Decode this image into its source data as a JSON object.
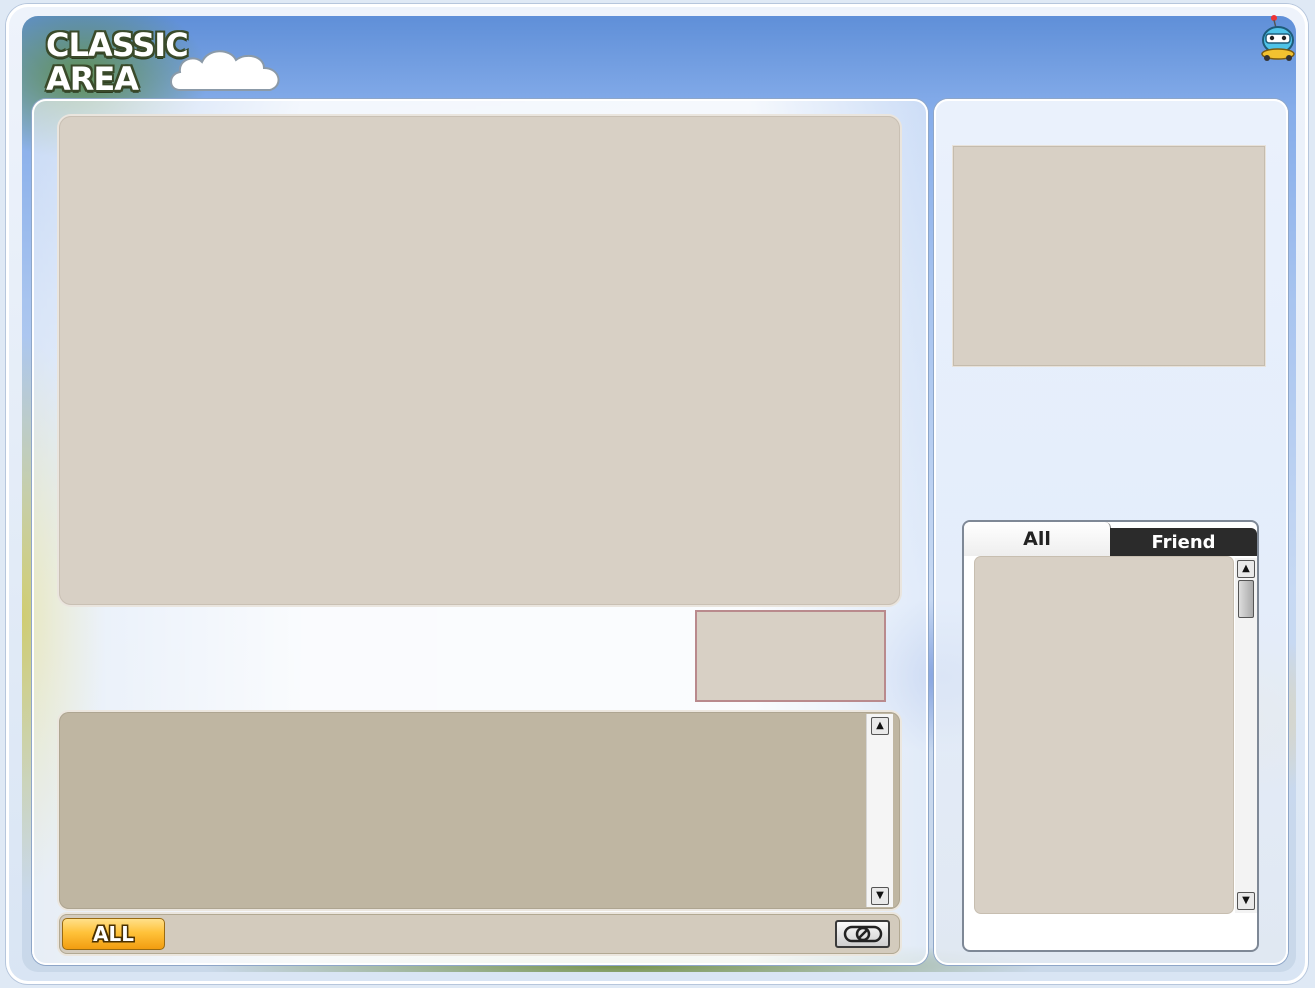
{
  "header": {
    "area_title_line1": "CLASSIC",
    "area_title_line2": "AREA"
  },
  "chat": {
    "channel_button": "ALL",
    "filter_icon": "no-chat-icon"
  },
  "players": {
    "tabs": [
      {
        "label": "All",
        "selected": true
      },
      {
        "label": "Friend",
        "selected": false
      }
    ]
  },
  "colors": {
    "panel_fill": "#d8d0c5",
    "chat_fill": "#bfb6a2",
    "all_button": "#ffc23a",
    "inactive_tab": "#2b2b2b"
  }
}
